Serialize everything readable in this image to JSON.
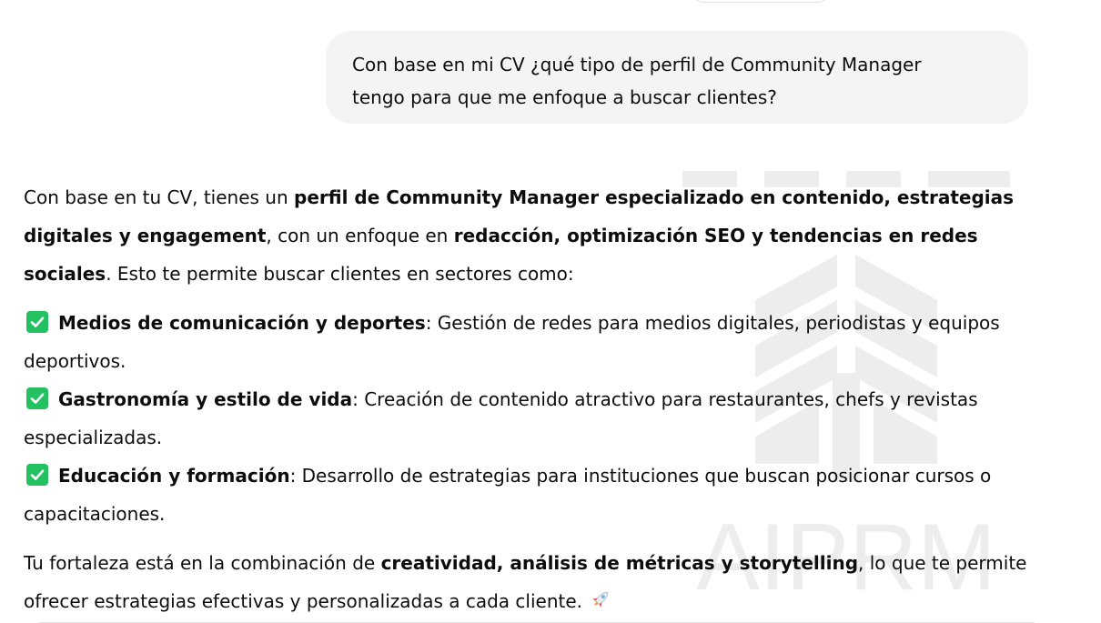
{
  "user_message": {
    "line1": "Con base en mi CV ¿qué tipo de perfil de Community Manager",
    "line2": "tengo para que me enfoque a buscar clientes?"
  },
  "assistant": {
    "intro": {
      "t1": "Con base en tu CV, tienes un ",
      "b1": "perfil de Community Manager especializado en contenido, estrategias digitales y engagement",
      "t2": ", con un enfoque en ",
      "b2": "redacción, optimización SEO y tendencias en redes sociales",
      "t3": ". Esto te permite buscar clientes en sectores como:"
    },
    "items": [
      {
        "title": "Medios de comunicación y deportes",
        "text": ": Gestión de redes para medios digitales, periodistas y equipos deportivos.",
        "icon": "check-mark-button-icon"
      },
      {
        "title": "Gastronomía y estilo de vida",
        "text": ": Creación de contenido atractivo para restaurantes, chefs y revistas especializadas.",
        "icon": "check-mark-button-icon"
      },
      {
        "title": "Educación y formación",
        "text": ": Desarrollo de estrategias para instituciones que buscan posicionar cursos o capacitaciones.",
        "icon": "check-mark-button-icon"
      }
    ],
    "closing": {
      "t1": "Tu fortaleza está en la combinación de ",
      "b1": "creatividad, análisis de métricas y storytelling",
      "t2": ", lo que te permite ofrecer estrategias efectivas y personalizadas a cada cliente.",
      "icon": "rocket-icon"
    }
  },
  "watermark": {
    "text": "AIPRM"
  },
  "colors": {
    "check_green": "#23c162",
    "bubble_bg": "#f4f4f4",
    "text": "#0d0d0d",
    "watermark": "#e9e9e9"
  }
}
